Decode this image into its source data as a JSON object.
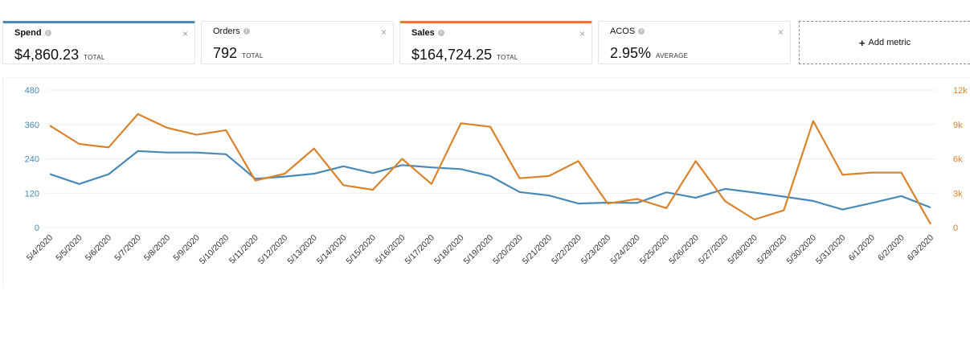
{
  "metrics": [
    {
      "label": "Spend",
      "value": "$4,860.23",
      "unit": "TOTAL"
    },
    {
      "label": "Orders",
      "value": "792",
      "unit": "TOTAL"
    },
    {
      "label": "Sales",
      "value": "$164,724.25",
      "unit": "TOTAL"
    },
    {
      "label": "ACOS",
      "value": "2.95%",
      "unit": "AVERAGE"
    }
  ],
  "add_metric_label": "Add metric",
  "icons": {
    "info": "info-icon",
    "close": "close-icon",
    "plus": "plus-icon"
  },
  "colors": {
    "spend": "#4a8ab6",
    "sales": "#d9832b",
    "grid": "#eceeee"
  },
  "chart_data": {
    "type": "line",
    "categories": [
      "5/4/2020",
      "5/5/2020",
      "5/6/2020",
      "5/7/2020",
      "5/8/2020",
      "5/9/2020",
      "5/10/2020",
      "5/11/2020",
      "5/12/2020",
      "5/13/2020",
      "5/14/2020",
      "5/15/2020",
      "5/16/2020",
      "5/17/2020",
      "5/18/2020",
      "5/19/2020",
      "5/20/2020",
      "5/21/2020",
      "5/22/2020",
      "5/23/2020",
      "5/24/2020",
      "5/25/2020",
      "5/26/2020",
      "5/27/2020",
      "5/28/2020",
      "5/29/2020",
      "5/30/2020",
      "5/31/2020",
      "6/1/2020",
      "6/2/2020",
      "6/3/2020"
    ],
    "series": [
      {
        "name": "Spend",
        "axis": "left",
        "values": [
          187,
          152,
          186,
          267,
          262,
          262,
          256,
          170,
          178,
          188,
          214,
          190,
          218,
          210,
          204,
          180,
          124,
          112,
          84,
          87,
          86,
          123,
          104,
          135,
          122,
          108,
          93,
          63,
          86,
          110,
          70
        ]
      },
      {
        "name": "Sales",
        "axis": "right",
        "values": [
          8900,
          7300,
          7000,
          9900,
          8700,
          8100,
          8500,
          4100,
          4700,
          6900,
          3700,
          3300,
          6000,
          3800,
          9100,
          8800,
          4300,
          4500,
          5800,
          2100,
          2500,
          1700,
          5800,
          2300,
          700,
          1500,
          9300,
          4600,
          4800,
          4800,
          300
        ]
      }
    ],
    "y_left": {
      "ticks": [
        "480",
        "360",
        "240",
        "120",
        "0"
      ],
      "range": [
        0,
        480
      ]
    },
    "y_right": {
      "ticks": [
        "12k",
        "9k",
        "6k",
        "3k",
        "0"
      ],
      "range": [
        0,
        12000
      ]
    },
    "grid": true
  }
}
